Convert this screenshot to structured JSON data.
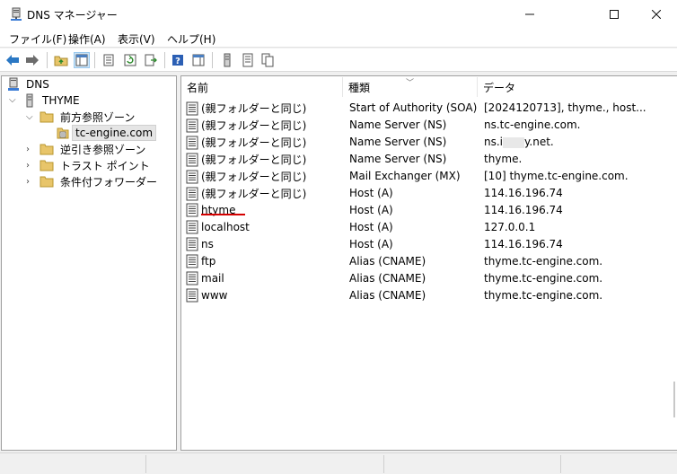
{
  "window": {
    "title": "DNS マネージャー",
    "minimize": "—",
    "maximize": "☐",
    "close": "✕"
  },
  "menu": [
    {
      "label": "ファイル(F)"
    },
    {
      "label": "操作(A)"
    },
    {
      "label": "表示(V)"
    },
    {
      "label": "ヘルプ(H)"
    }
  ],
  "toolbar": {
    "buttons": [
      "back-icon",
      "forward-icon",
      "up-folder-icon",
      "show-tree-icon",
      "properties-icon",
      "refresh-icon",
      "export-list-icon",
      "help-icon",
      "show-action-pane-icon",
      "server-icon",
      "zone-list-icon",
      "copy-icon"
    ]
  },
  "tree": {
    "root": "DNS",
    "server": "THYME",
    "forward": "前方参照ゾーン",
    "zone": "tc-engine.com",
    "reverse": "逆引き参照ゾーン",
    "trust": "トラスト ポイント",
    "conditional": "条件付フォワーダー"
  },
  "list": {
    "headers": [
      "名前",
      "種類",
      "データ"
    ],
    "rows": [
      {
        "name": "(親フォルダーと同じ)",
        "type": "Start of Authority (SOA)",
        "data": "[2024120713], thyme., host..."
      },
      {
        "name": "(親フォルダーと同じ)",
        "type": "Name Server (NS)",
        "data": "ns.tc-engine.com."
      },
      {
        "name": "(親フォルダーと同じ)",
        "type": "Name Server (NS)",
        "data_pre": "ns.i",
        "data_post": "y.net."
      },
      {
        "name": "(親フォルダーと同じ)",
        "type": "Name Server (NS)",
        "data": "thyme."
      },
      {
        "name": "(親フォルダーと同じ)",
        "type": "Mail Exchanger (MX)",
        "data": "[10]  thyme.tc-engine.com."
      },
      {
        "name": "(親フォルダーと同じ)",
        "type": "Host (A)",
        "data": "114.16.196.74"
      },
      {
        "name": "htyme",
        "type": "Host (A)",
        "data": "114.16.196.74"
      },
      {
        "name": "localhost",
        "type": "Host (A)",
        "data": "127.0.0.1"
      },
      {
        "name": "ns",
        "type": "Host (A)",
        "data": "114.16.196.74"
      },
      {
        "name": "ftp",
        "type": "Alias (CNAME)",
        "data": "thyme.tc-engine.com."
      },
      {
        "name": "mail",
        "type": "Alias (CNAME)",
        "data": "thyme.tc-engine.com."
      },
      {
        "name": "www",
        "type": "Alias (CNAME)",
        "data": "thyme.tc-engine.com."
      }
    ]
  },
  "colors": {
    "selection": "#e5e5e5",
    "annotation": "#d40000",
    "folder": "#e8c56a"
  }
}
